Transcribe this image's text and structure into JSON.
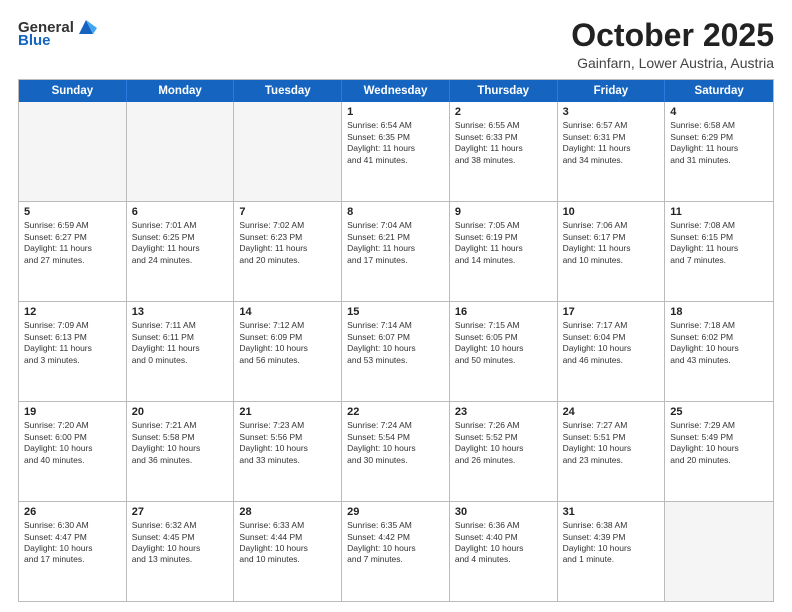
{
  "header": {
    "logo_general": "General",
    "logo_blue": "Blue",
    "month_title": "October 2025",
    "location": "Gainfarn, Lower Austria, Austria"
  },
  "days_of_week": [
    "Sunday",
    "Monday",
    "Tuesday",
    "Wednesday",
    "Thursday",
    "Friday",
    "Saturday"
  ],
  "rows": [
    [
      {
        "day": "",
        "empty": true
      },
      {
        "day": "",
        "empty": true
      },
      {
        "day": "",
        "empty": true
      },
      {
        "day": "1",
        "lines": [
          "Sunrise: 6:54 AM",
          "Sunset: 6:35 PM",
          "Daylight: 11 hours",
          "and 41 minutes."
        ]
      },
      {
        "day": "2",
        "lines": [
          "Sunrise: 6:55 AM",
          "Sunset: 6:33 PM",
          "Daylight: 11 hours",
          "and 38 minutes."
        ]
      },
      {
        "day": "3",
        "lines": [
          "Sunrise: 6:57 AM",
          "Sunset: 6:31 PM",
          "Daylight: 11 hours",
          "and 34 minutes."
        ]
      },
      {
        "day": "4",
        "lines": [
          "Sunrise: 6:58 AM",
          "Sunset: 6:29 PM",
          "Daylight: 11 hours",
          "and 31 minutes."
        ]
      }
    ],
    [
      {
        "day": "5",
        "lines": [
          "Sunrise: 6:59 AM",
          "Sunset: 6:27 PM",
          "Daylight: 11 hours",
          "and 27 minutes."
        ]
      },
      {
        "day": "6",
        "lines": [
          "Sunrise: 7:01 AM",
          "Sunset: 6:25 PM",
          "Daylight: 11 hours",
          "and 24 minutes."
        ]
      },
      {
        "day": "7",
        "lines": [
          "Sunrise: 7:02 AM",
          "Sunset: 6:23 PM",
          "Daylight: 11 hours",
          "and 20 minutes."
        ]
      },
      {
        "day": "8",
        "lines": [
          "Sunrise: 7:04 AM",
          "Sunset: 6:21 PM",
          "Daylight: 11 hours",
          "and 17 minutes."
        ]
      },
      {
        "day": "9",
        "lines": [
          "Sunrise: 7:05 AM",
          "Sunset: 6:19 PM",
          "Daylight: 11 hours",
          "and 14 minutes."
        ]
      },
      {
        "day": "10",
        "lines": [
          "Sunrise: 7:06 AM",
          "Sunset: 6:17 PM",
          "Daylight: 11 hours",
          "and 10 minutes."
        ]
      },
      {
        "day": "11",
        "lines": [
          "Sunrise: 7:08 AM",
          "Sunset: 6:15 PM",
          "Daylight: 11 hours",
          "and 7 minutes."
        ]
      }
    ],
    [
      {
        "day": "12",
        "lines": [
          "Sunrise: 7:09 AM",
          "Sunset: 6:13 PM",
          "Daylight: 11 hours",
          "and 3 minutes."
        ]
      },
      {
        "day": "13",
        "lines": [
          "Sunrise: 7:11 AM",
          "Sunset: 6:11 PM",
          "Daylight: 11 hours",
          "and 0 minutes."
        ]
      },
      {
        "day": "14",
        "lines": [
          "Sunrise: 7:12 AM",
          "Sunset: 6:09 PM",
          "Daylight: 10 hours",
          "and 56 minutes."
        ]
      },
      {
        "day": "15",
        "lines": [
          "Sunrise: 7:14 AM",
          "Sunset: 6:07 PM",
          "Daylight: 10 hours",
          "and 53 minutes."
        ]
      },
      {
        "day": "16",
        "lines": [
          "Sunrise: 7:15 AM",
          "Sunset: 6:05 PM",
          "Daylight: 10 hours",
          "and 50 minutes."
        ]
      },
      {
        "day": "17",
        "lines": [
          "Sunrise: 7:17 AM",
          "Sunset: 6:04 PM",
          "Daylight: 10 hours",
          "and 46 minutes."
        ]
      },
      {
        "day": "18",
        "lines": [
          "Sunrise: 7:18 AM",
          "Sunset: 6:02 PM",
          "Daylight: 10 hours",
          "and 43 minutes."
        ]
      }
    ],
    [
      {
        "day": "19",
        "lines": [
          "Sunrise: 7:20 AM",
          "Sunset: 6:00 PM",
          "Daylight: 10 hours",
          "and 40 minutes."
        ]
      },
      {
        "day": "20",
        "lines": [
          "Sunrise: 7:21 AM",
          "Sunset: 5:58 PM",
          "Daylight: 10 hours",
          "and 36 minutes."
        ]
      },
      {
        "day": "21",
        "lines": [
          "Sunrise: 7:23 AM",
          "Sunset: 5:56 PM",
          "Daylight: 10 hours",
          "and 33 minutes."
        ]
      },
      {
        "day": "22",
        "lines": [
          "Sunrise: 7:24 AM",
          "Sunset: 5:54 PM",
          "Daylight: 10 hours",
          "and 30 minutes."
        ]
      },
      {
        "day": "23",
        "lines": [
          "Sunrise: 7:26 AM",
          "Sunset: 5:52 PM",
          "Daylight: 10 hours",
          "and 26 minutes."
        ]
      },
      {
        "day": "24",
        "lines": [
          "Sunrise: 7:27 AM",
          "Sunset: 5:51 PM",
          "Daylight: 10 hours",
          "and 23 minutes."
        ]
      },
      {
        "day": "25",
        "lines": [
          "Sunrise: 7:29 AM",
          "Sunset: 5:49 PM",
          "Daylight: 10 hours",
          "and 20 minutes."
        ]
      }
    ],
    [
      {
        "day": "26",
        "lines": [
          "Sunrise: 6:30 AM",
          "Sunset: 4:47 PM",
          "Daylight: 10 hours",
          "and 17 minutes."
        ]
      },
      {
        "day": "27",
        "lines": [
          "Sunrise: 6:32 AM",
          "Sunset: 4:45 PM",
          "Daylight: 10 hours",
          "and 13 minutes."
        ]
      },
      {
        "day": "28",
        "lines": [
          "Sunrise: 6:33 AM",
          "Sunset: 4:44 PM",
          "Daylight: 10 hours",
          "and 10 minutes."
        ]
      },
      {
        "day": "29",
        "lines": [
          "Sunrise: 6:35 AM",
          "Sunset: 4:42 PM",
          "Daylight: 10 hours",
          "and 7 minutes."
        ]
      },
      {
        "day": "30",
        "lines": [
          "Sunrise: 6:36 AM",
          "Sunset: 4:40 PM",
          "Daylight: 10 hours",
          "and 4 minutes."
        ]
      },
      {
        "day": "31",
        "lines": [
          "Sunrise: 6:38 AM",
          "Sunset: 4:39 PM",
          "Daylight: 10 hours",
          "and 1 minute."
        ]
      },
      {
        "day": "",
        "empty": true
      }
    ]
  ]
}
